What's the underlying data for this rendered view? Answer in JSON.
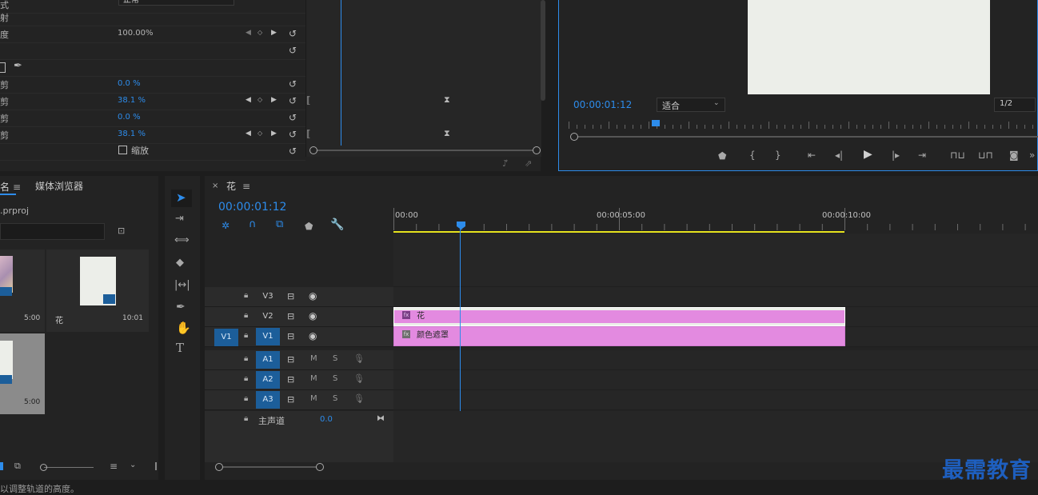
{
  "effect_controls": {
    "rows": [
      {
        "label": "混合模式",
        "value": "正常",
        "kind": "select"
      },
      {
        "label": "通道映射",
        "value": "",
        "kind": "text"
      },
      {
        "label": "不透明度",
        "value": "100.00%",
        "kind": "plain"
      },
      {
        "label": "",
        "value": "",
        "kind": "blank"
      },
      {
        "label": "",
        "value": "",
        "kind": "mask-tools"
      },
      {
        "label": "顶部裁剪",
        "value": "0.0 %",
        "kind": "blue"
      },
      {
        "label": "底部裁剪",
        "value": "38.1 %",
        "kind": "blue-key"
      },
      {
        "label": "左侧裁剪",
        "value": "0.0 %",
        "kind": "blue"
      },
      {
        "label": "右侧裁剪",
        "value": "38.1 %",
        "kind": "blue-key"
      },
      {
        "label": "",
        "value": "缩放",
        "kind": "checkbox"
      }
    ]
  },
  "program_monitor": {
    "timecode": "00:00:01:12",
    "fit_label": "适合",
    "resolution": "1/2",
    "preview_color": "#eceee9"
  },
  "project_panel": {
    "tab_partial": "名",
    "tab_media_browser": "媒体浏览器",
    "project_file": ".prproj",
    "items": [
      {
        "name": "",
        "duration": "5:00"
      },
      {
        "name": "花",
        "duration": "10:01"
      },
      {
        "name": "",
        "duration": "5:00"
      }
    ]
  },
  "timeline": {
    "sequence_name": "花",
    "timecode": "00:00:01:12",
    "ruler": [
      "00:00",
      "00:00:05:00",
      "00:00:10:00"
    ],
    "video_tracks": [
      "V3",
      "V2",
      "V1"
    ],
    "source_patch": "V1",
    "audio_tracks": [
      "A1",
      "A2",
      "A3"
    ],
    "mute_label": "M",
    "solo_label": "S",
    "master_label": "主声道",
    "master_value": "0.0",
    "clips": [
      {
        "track": "V2",
        "name": "花"
      },
      {
        "track": "V1",
        "name": "颜色遮罩"
      }
    ],
    "clip_color": "#e38ae0",
    "accent": "#2d8ceb",
    "work_area_color": "#e5e21e"
  },
  "status_bar": {
    "text": "以调整轨道的高度。"
  },
  "watermark": "最需教育"
}
